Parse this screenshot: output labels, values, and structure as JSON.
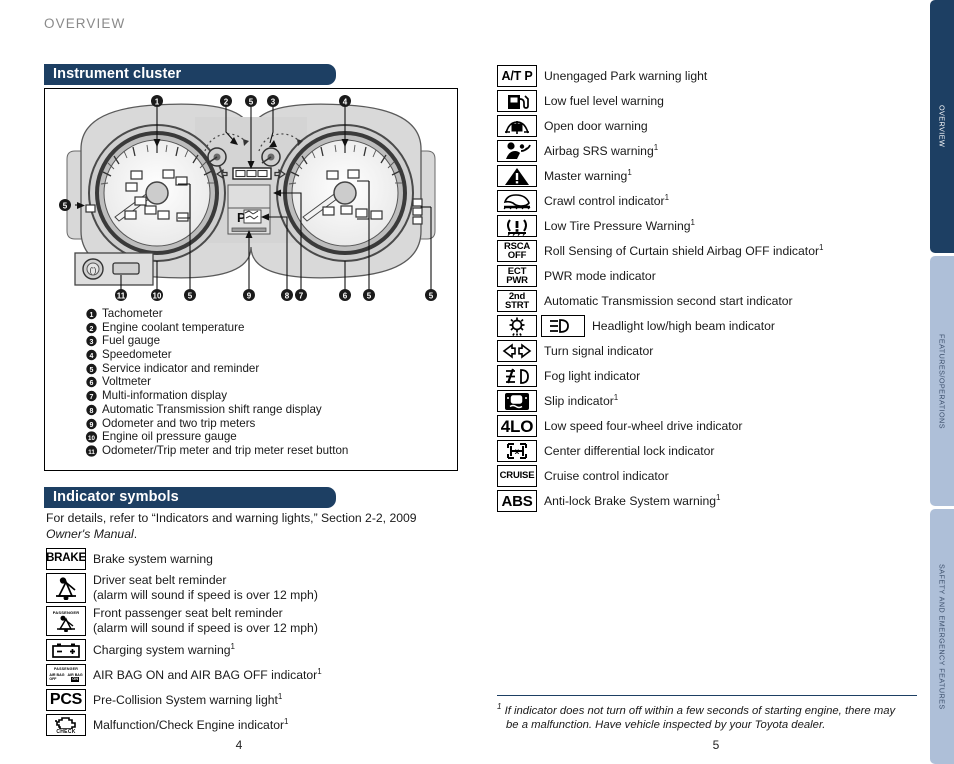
{
  "running_head": "OVERVIEW",
  "sections": {
    "instrument_cluster": {
      "title": "Instrument cluster"
    },
    "indicator_symbols": {
      "title": "Indicator symbols",
      "intro_line1": "For details, refer to “Indicators and warning lights,” Section 2-2, 2009",
      "intro_line2_italic": "Owner's Manual",
      "intro_line2_tail": "."
    }
  },
  "cluster_legend": [
    {
      "num": "1",
      "label": "Tachometer"
    },
    {
      "num": "2",
      "label": "Engine coolant temperature"
    },
    {
      "num": "3",
      "label": "Fuel gauge"
    },
    {
      "num": "4",
      "label": "Speedometer"
    },
    {
      "num": "5",
      "label": "Service indicator and reminder"
    },
    {
      "num": "6",
      "label": "Voltmeter"
    },
    {
      "num": "7",
      "label": "Multi-information display"
    },
    {
      "num": "8",
      "label": "Automatic Transmission shift range display"
    },
    {
      "num": "9",
      "label": "Odometer and two trip meters"
    },
    {
      "num": "10",
      "label": "Engine oil pressure gauge"
    },
    {
      "num": "11",
      "label": "Odometer/Trip meter and trip meter reset button"
    }
  ],
  "cluster_callouts": [
    "1",
    "2",
    "3",
    "4",
    "5",
    "6",
    "7",
    "8",
    "9",
    "10",
    "11"
  ],
  "left_symbols": [
    {
      "icon": "brake-text-icon",
      "icon_text": "BRAKE",
      "label": "Brake system warning",
      "footnote": false
    },
    {
      "icon": "driver-seatbelt-icon",
      "icon_text": "",
      "label": "Driver seat belt reminder",
      "label2": "(alarm will sound if speed is over 12 mph)",
      "footnote": false
    },
    {
      "icon": "passenger-seatbelt-icon",
      "icon_text": "PASSENGER",
      "label": "Front passenger seat belt reminder",
      "label2": "(alarm will sound if speed is over 12 mph)",
      "footnote": false
    },
    {
      "icon": "battery-charging-icon",
      "icon_text": "",
      "label": "Charging system warning",
      "footnote": true
    },
    {
      "icon": "airbag-on-off-icon",
      "icon_text": "PASSENGER",
      "icon_sub_left": "AIR BAG OFF",
      "icon_sub_right": "AIR BAG ON",
      "label": "AIR BAG ON and AIR BAG OFF indicator",
      "footnote": true
    },
    {
      "icon": "pcs-text-icon",
      "icon_text": "PCS",
      "label": "Pre-Collision System warning light",
      "footnote": true
    },
    {
      "icon": "check-engine-icon",
      "icon_text": "CHECK",
      "label": "Malfunction/Check Engine indicator",
      "footnote": true
    }
  ],
  "right_symbols": [
    {
      "icon": "at-p-text-icon",
      "icon_text": "A/T P",
      "label": "Unengaged Park warning light",
      "footnote": false
    },
    {
      "icon": "fuel-pump-icon",
      "icon_text": "",
      "label": "Low fuel level warning",
      "footnote": false
    },
    {
      "icon": "open-door-icon",
      "icon_text": "",
      "label": "Open door warning",
      "footnote": false
    },
    {
      "icon": "airbag-srs-icon",
      "icon_text": "",
      "label": "Airbag SRS warning",
      "footnote": true
    },
    {
      "icon": "master-warning-icon",
      "icon_text": "",
      "label": "Master warning",
      "footnote": true
    },
    {
      "icon": "crawl-control-icon",
      "icon_text": "",
      "label": "Crawl control indicator",
      "footnote": true
    },
    {
      "icon": "low-tire-pressure-icon",
      "icon_text": "",
      "label": "Low Tire Pressure Warning",
      "footnote": true
    },
    {
      "icon": "rsca-off-text-icon",
      "icon_text": "RSCA",
      "icon_text2": "OFF",
      "label": "Roll Sensing of Curtain shield Airbag OFF indicator",
      "footnote": true
    },
    {
      "icon": "ect-pwr-text-icon",
      "icon_text": "ECT",
      "icon_text2": "PWR",
      "label": "PWR mode indicator",
      "footnote": false
    },
    {
      "icon": "second-start-text-icon",
      "icon_text": "2nd",
      "icon_text2": "STRT",
      "label": "Automatic Transmission second start indicator",
      "footnote": false
    },
    {
      "icon": "headlight-low-beam-icon",
      "icon2": "headlight-high-beam-icon",
      "icon_text": "",
      "label": "Headlight low/high beam indicator",
      "footnote": false
    },
    {
      "icon": "turn-signal-icon",
      "icon_text": "",
      "label": "Turn signal indicator",
      "footnote": false
    },
    {
      "icon": "fog-light-icon",
      "icon_text": "",
      "label": "Fog light indicator",
      "footnote": false
    },
    {
      "icon": "slip-indicator-icon",
      "icon_text": "",
      "label": "Slip indicator",
      "footnote": true
    },
    {
      "icon": "four-lo-text-icon",
      "icon_text": "4LO",
      "label": "Low speed four-wheel drive indicator",
      "footnote": false
    },
    {
      "icon": "center-diff-lock-icon",
      "icon_text": "",
      "label": "Center differential lock indicator",
      "footnote": false
    },
    {
      "icon": "cruise-text-icon",
      "icon_text": "CRUISE",
      "label": "Cruise control indicator",
      "footnote": false
    },
    {
      "icon": "abs-text-icon",
      "icon_text": "ABS",
      "label": "Anti-lock Brake System warning",
      "footnote": true
    }
  ],
  "footnote": {
    "mark": "1",
    "line1": "If indicator does not turn off within a few seconds of starting engine, there may",
    "line2": "be a malfunction. Have vehicle inspected by your Toyota dealer."
  },
  "page_numbers": {
    "left": "4",
    "right": "5"
  },
  "tabs": [
    {
      "label": "OVERVIEW",
      "active": true
    },
    {
      "label": "FEATURES/OPERATIONS",
      "active": false
    },
    {
      "label": "SAFETY AND EMERGENCY FEATURES",
      "active": false
    }
  ],
  "colors": {
    "navy": "#1d3f63",
    "tab_inactive": "#aebfd8",
    "running_head": "#8a8a8a",
    "body_text": "#1a1a1a"
  }
}
